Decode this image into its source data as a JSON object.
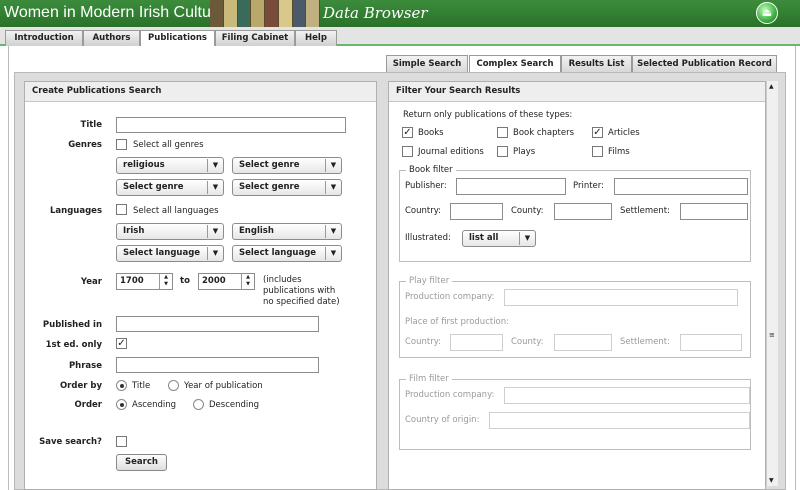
{
  "banner": {
    "title": "Women in Modern Irish Culture",
    "subtitle": "Data Browser"
  },
  "top_tabs": [
    "Introduction",
    "Authors",
    "Publications",
    "Filing Cabinet",
    "Help"
  ],
  "sub_tabs": [
    "Simple Search",
    "Complex Search",
    "Results List",
    "Selected Publication Record"
  ],
  "left": {
    "heading": "Create Publications Search",
    "title_label": "Title",
    "genres_label": "Genres",
    "select_all_genres": "Select all genres",
    "genre_selects": [
      "religious",
      "Select genre",
      "Select genre",
      "Select genre"
    ],
    "languages_label": "Languages",
    "select_all_languages": "Select all languages",
    "language_selects": [
      "Irish",
      "English",
      "Select language",
      "Select language"
    ],
    "year_label": "Year",
    "year_from": "1700",
    "to": "to",
    "year_to": "2000",
    "year_note": [
      "(includes",
      "publications with",
      "no specified date)"
    ],
    "published_in_label": "Published in",
    "first_ed_label": "1st ed. only",
    "first_ed_checked": true,
    "phrase_label": "Phrase",
    "order_by_label": "Order by",
    "order_by_options": [
      "Title",
      "Year of publication"
    ],
    "order_label": "Order",
    "order_options": [
      "Ascending",
      "Descending"
    ],
    "save_label": "Save search?",
    "search_button": "Search"
  },
  "right": {
    "heading": "Filter Your Search Results",
    "types_label": "Return only publications of these types:",
    "types": [
      {
        "label": "Books",
        "checked": true
      },
      {
        "label": "Book chapters",
        "checked": false
      },
      {
        "label": "Articles",
        "checked": true
      },
      {
        "label": "Journal editions",
        "checked": false
      },
      {
        "label": "Plays",
        "checked": false
      },
      {
        "label": "Films",
        "checked": false
      }
    ],
    "book_filter": {
      "legend": "Book filter",
      "publisher": "Publisher:",
      "printer": "Printer:",
      "country": "Country:",
      "county": "County:",
      "settlement": "Settlement:",
      "illustrated": "Illustrated:",
      "illustrated_value": "list all"
    },
    "play_filter": {
      "legend": "Play filter",
      "production_company": "Production company:",
      "place": "Place of first production:",
      "country": "Country:",
      "county": "County:",
      "settlement": "Settlement:"
    },
    "film_filter": {
      "legend": "Film filter",
      "production_company": "Production company:",
      "country_origin": "Country of origin:"
    }
  }
}
